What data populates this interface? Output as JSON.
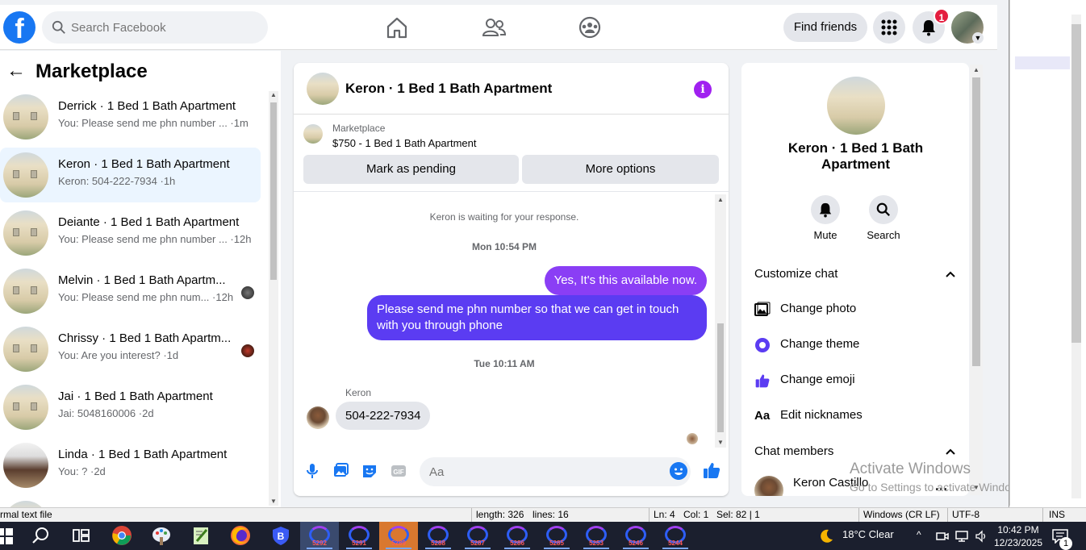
{
  "search": {
    "placeholder": "Search Facebook"
  },
  "header": {
    "find_friends": "Find friends",
    "notification_count": "1"
  },
  "sidebar": {
    "title": "Marketplace",
    "conversations": [
      {
        "name": "Derrick · 1 Bed 1 Bath Apartment",
        "preview": "You: Please send me phn number ... ·1m"
      },
      {
        "name": "Keron · 1 Bed 1 Bath Apartment",
        "preview": "Keron: 504-222-7934 ·1h"
      },
      {
        "name": "Deiante · 1 Bed 1 Bath Apartment",
        "preview": "You: Please send me phn number ... ·12h"
      },
      {
        "name": "Melvin · 1 Bed 1 Bath Apartm...",
        "preview": "You: Please send me phn num... ·12h"
      },
      {
        "name": "Chrissy · 1 Bed 1 Bath Apartm...",
        "preview": "You: Are you interest? ·1d"
      },
      {
        "name": "Jai · 1 Bed 1 Bath Apartment",
        "preview": "Jai: 5048160006 ·2d"
      },
      {
        "name": "Linda · 1 Bed 1 Bath Apartment",
        "preview": "You: ? ·2d"
      }
    ]
  },
  "chat": {
    "title": "Keron · 1 Bed 1 Bath Apartment",
    "info_icon": "i",
    "listing": {
      "label": "Marketplace",
      "price_title": "$750 - 1 Bed 1 Bath Apartment"
    },
    "mark_pending": "Mark as pending",
    "more_options": "More options",
    "waiting_text": "Keron is waiting for your response.",
    "timestamp1": "Mon 10:54 PM",
    "outgoing1": "Yes, It's this available now.",
    "outgoing2": "Please send me  phn  number so that we can get in touch with you through phone",
    "timestamp2": "Tue 10:11 AM",
    "sender_name": "Keron",
    "incoming1": "504-222-7934",
    "input_placeholder": "Aa"
  },
  "details": {
    "title": "Keron · 1 Bed 1 Bath Apartment",
    "mute": "Mute",
    "search": "Search",
    "customize_header": "Customize chat",
    "change_photo": "Change photo",
    "change_theme": "Change theme",
    "change_emoji": "Change emoji",
    "edit_nicknames": "Edit nicknames",
    "nicknames_icon_text": "Aa",
    "members_header": "Chat members",
    "member_name": "Keron Castillo",
    "member_more": "..."
  },
  "watermark": {
    "line1": "Activate Windows",
    "line2": "Go to Settings to activate Windows."
  },
  "editor_status": {
    "file_type": "rmal text file",
    "length": "length: 326",
    "lines": "lines: 16",
    "ln": "Ln: 4",
    "col": "Col: 1",
    "sel": "Sel: 82 | 1",
    "eol": "Windows (CR LF)",
    "encoding": "UTF-8",
    "mode": "INS"
  },
  "taskbar": {
    "apps": [
      "5292",
      "5291",
      "5289",
      "5288",
      "5287",
      "5286",
      "5285",
      "5253",
      "5246",
      "5244"
    ],
    "weather": "18°C  Clear",
    "time": "10:42 PM",
    "date": "12/23/2025",
    "notification_count": "1"
  },
  "colors": {
    "facebook_blue": "#1877f2",
    "outgoing_bubble": "#5b3cf2",
    "active_conversation": "#ebf5ff",
    "notification_red": "#e41e3f",
    "info_purple": "#a020f0"
  }
}
